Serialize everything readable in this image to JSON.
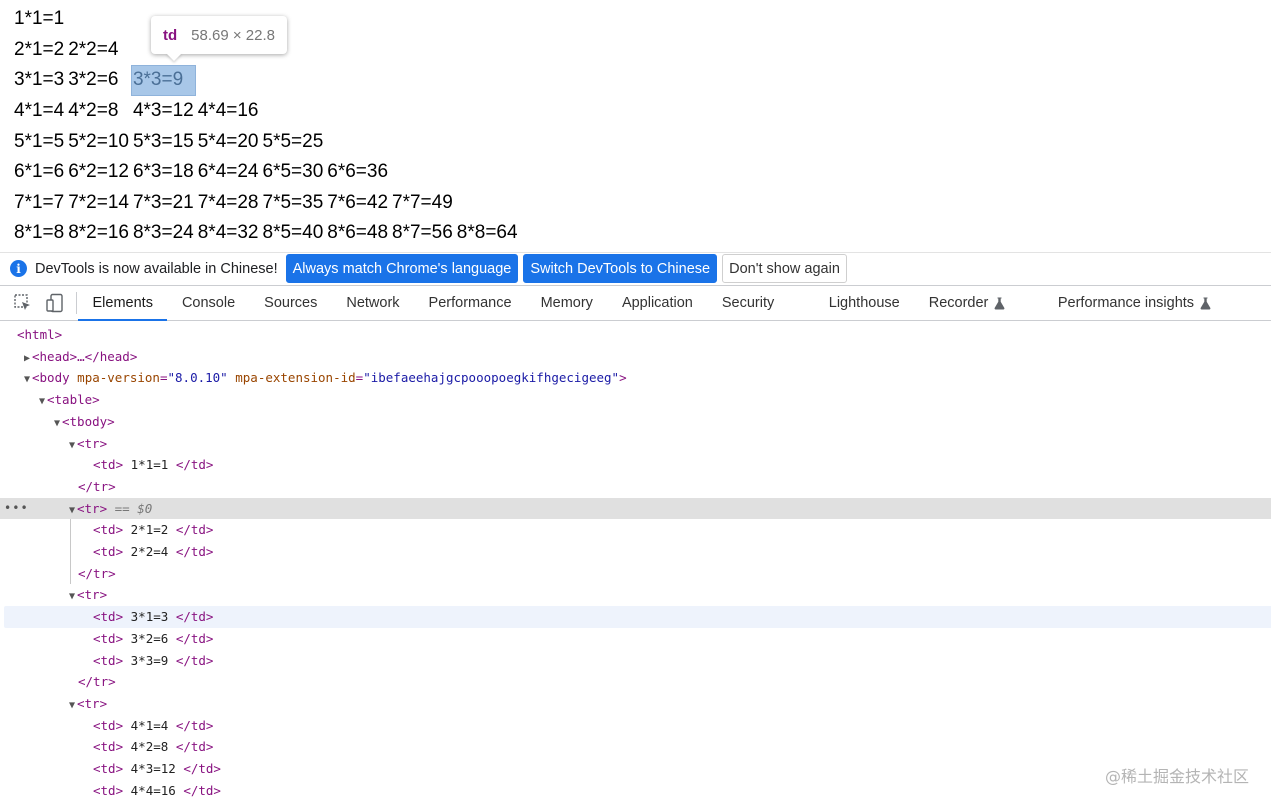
{
  "table": {
    "rows": [
      [
        "1*1=1"
      ],
      [
        "2*1=2",
        "2*2=4"
      ],
      [
        "3*1=3",
        "3*2=6",
        "3*3=9"
      ],
      [
        "4*1=4",
        "4*2=8",
        "4*3=12",
        "4*4=16"
      ],
      [
        "5*1=5",
        "5*2=10",
        "5*3=15",
        "5*4=20",
        "5*5=25"
      ],
      [
        "6*1=6",
        "6*2=12",
        "6*3=18",
        "6*4=24",
        "6*5=30",
        "6*6=36"
      ],
      [
        "7*1=7",
        "7*2=14",
        "7*3=21",
        "7*4=28",
        "7*5=35",
        "7*6=42",
        "7*7=49"
      ],
      [
        "8*1=8",
        "8*2=16",
        "8*3=24",
        "8*4=32",
        "8*5=40",
        "8*6=48",
        "8*7=56",
        "8*8=64"
      ]
    ]
  },
  "tooltip": {
    "tag": "td",
    "size": "58.69 × 22.8"
  },
  "infobar": {
    "icon": "info-icon",
    "message": "DevTools is now available in Chinese!",
    "btn_match": "Always match Chrome's language",
    "btn_switch": "Switch DevTools to Chinese",
    "btn_dismiss": "Don't show again"
  },
  "tabs": [
    {
      "label": "Elements",
      "active": true
    },
    {
      "label": "Console"
    },
    {
      "label": "Sources"
    },
    {
      "label": "Network"
    },
    {
      "label": "Performance"
    },
    {
      "label": "Memory"
    },
    {
      "label": "Application"
    },
    {
      "label": "Security"
    },
    {
      "label": "Lighthouse"
    },
    {
      "label": "Recorder",
      "flask": true
    },
    {
      "label": "Performance insights",
      "flask": true
    }
  ],
  "tree": {
    "html_open": "<html>",
    "head": "<head>…</head>",
    "body_open": "<body",
    "body_attr1_name": "mpa-version",
    "body_attr1_value": "\"8.0.10\"",
    "body_attr2_name": "mpa-extension-id",
    "body_attr2_value": "\"ibefaeehajgcpooopoegkifhgecigeeg\"",
    "body_close_bracket": ">",
    "table_open": "<table>",
    "tbody_open": "<tbody>",
    "tr_open": "<tr>",
    "tr_close": "</tr>",
    "td_open": "<td>",
    "td_close": "</td>",
    "selected_suffix": "== $0",
    "ellipsis": "•••",
    "cells": [
      "1*1=1",
      "2*1=2",
      "2*2=4",
      "3*1=3",
      "3*2=6",
      "3*3=9",
      "4*1=4",
      "4*2=8",
      "4*3=12",
      "4*4=16"
    ]
  },
  "watermark": "@稀土掘金技术社区"
}
